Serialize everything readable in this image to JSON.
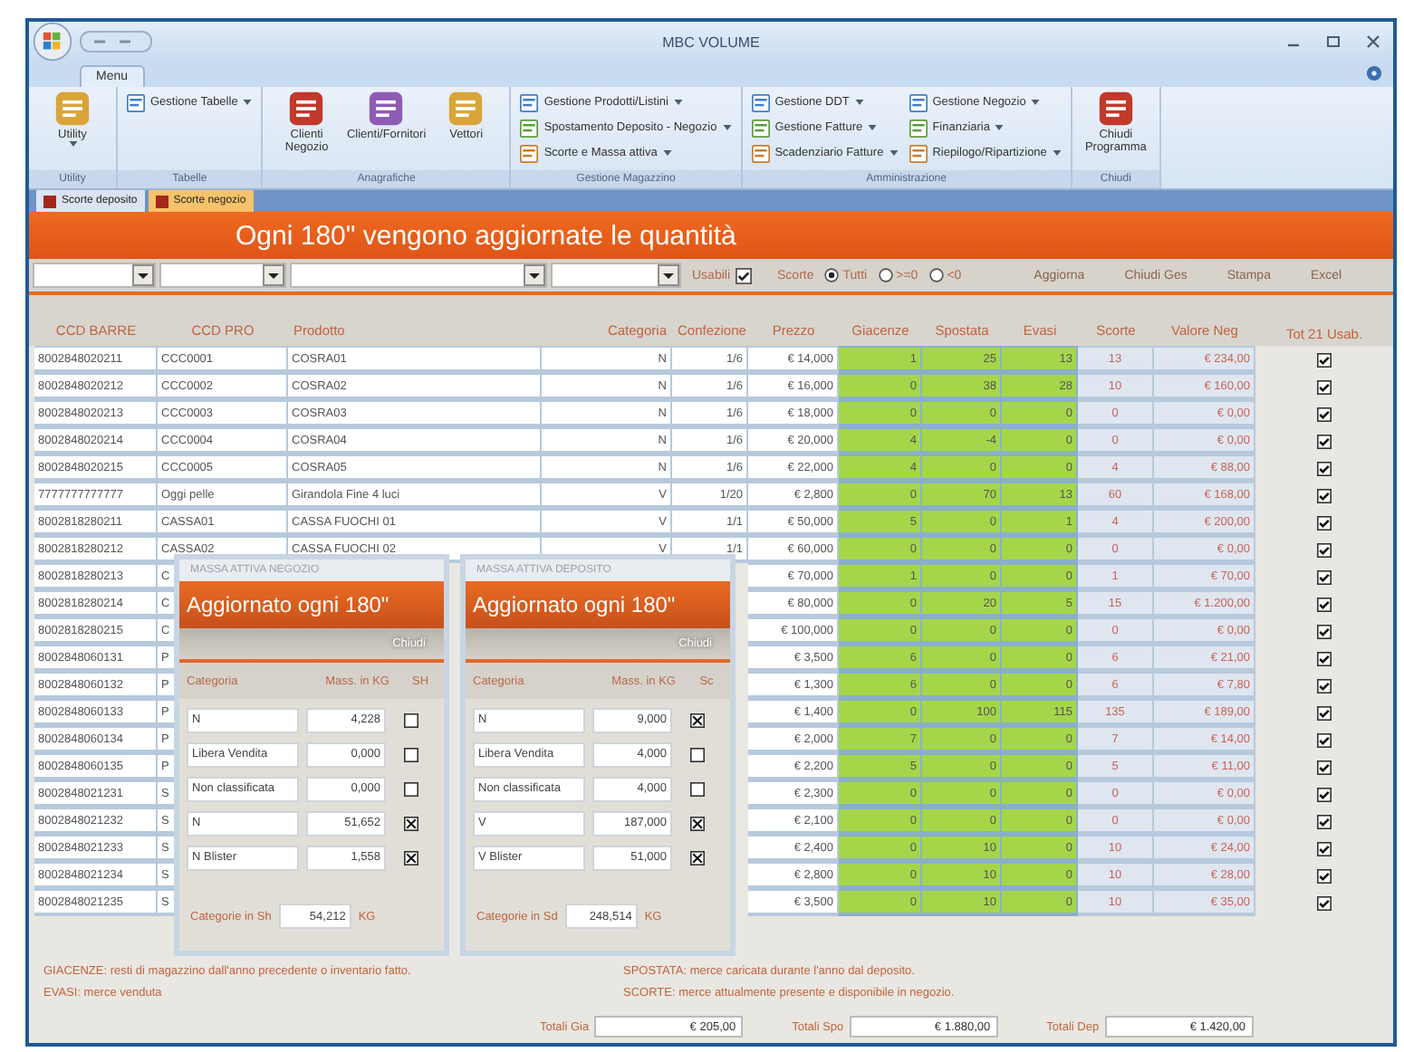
{
  "window": {
    "title": "MBC VOLUME"
  },
  "ribbon": {
    "tabs": [
      {
        "label": "Menu",
        "selected": true
      }
    ],
    "groups": [
      {
        "label": "Utility",
        "items": [
          {
            "label": "Utility",
            "kind": "large",
            "dropdown": true
          }
        ]
      },
      {
        "label": "Tabelle",
        "items": [
          {
            "label": "Gestione Tabelle",
            "kind": "small",
            "dropdown": true
          }
        ]
      },
      {
        "label": "Anagrafiche",
        "items": [
          {
            "label": "Clienti Negozio",
            "kind": "large",
            "dropdown": false
          },
          {
            "label": "Clienti/Fornitori",
            "kind": "large",
            "dropdown": false
          },
          {
            "label": "Vettori",
            "kind": "large",
            "dropdown": false
          }
        ]
      },
      {
        "label": "Gestione Magazzino",
        "items": [
          {
            "label": "Gestione Prodotti/Listini",
            "kind": "small",
            "dropdown": true
          },
          {
            "label": "Spostamento Deposito - Negozio",
            "kind": "small",
            "dropdown": true
          },
          {
            "label": "Scorte e Massa attiva",
            "kind": "small",
            "dropdown": true
          }
        ]
      },
      {
        "label": "Amministrazione",
        "items": [
          {
            "label": "Gestione DDT",
            "kind": "small",
            "dropdown": true
          },
          {
            "label": "Gestione Fatture",
            "kind": "small",
            "dropdown": true
          },
          {
            "label": "Scadenziario Fatture",
            "kind": "small",
            "dropdown": true
          },
          {
            "label": "Gestione Negozio",
            "kind": "small",
            "dropdown": true
          },
          {
            "label": "Finanziaria",
            "kind": "small",
            "dropdown": true
          },
          {
            "label": "Riepilogo/Ripartizione",
            "kind": "small",
            "dropdown": true
          }
        ]
      },
      {
        "label": "Chiudi",
        "items": [
          {
            "label": "Chiudi Programma",
            "kind": "large",
            "dropdown": false
          }
        ]
      }
    ]
  },
  "doc_tabs": [
    {
      "label": "Scorte deposito",
      "selected": false
    },
    {
      "label": "Scorte negozio",
      "selected": true
    }
  ],
  "banner": "Ogni 180\" vengono aggiornate le quantità",
  "filters": {
    "usable": {
      "label": "Usabili",
      "checked": true
    },
    "stock_filter": {
      "label": "Scorte",
      "options": [
        {
          "label": "Tutti",
          "selected": true
        },
        {
          "label": ">=0",
          "selected": false
        },
        {
          "label": "<0",
          "selected": false
        }
      ]
    },
    "buttons": [
      "Aggiorna",
      "Chiudi Ges",
      "Stampa",
      "Excel"
    ]
  },
  "table": {
    "columns": [
      "CCD BARRE",
      "CCD PRO",
      "Prodotto",
      "Categoria",
      "Confezione",
      "Prezzo",
      "Giacenze",
      "Spostata",
      "Evasi",
      "Scorte",
      "Valore Neg",
      "Tot 21 Usab."
    ],
    "rows": [
      {
        "barcode": "8002848020211",
        "code": "CCC0001",
        "product": "COSRA01",
        "category": "N",
        "pack": "1/6",
        "price": "€ 14,000",
        "stock_start": "1",
        "moved": "25",
        "sold": "13",
        "stock": "13",
        "value": "€ 234,00",
        "usable": true
      },
      {
        "barcode": "8002848020212",
        "code": "CCC0002",
        "product": "COSRA02",
        "category": "N",
        "pack": "1/6",
        "price": "€ 16,000",
        "stock_start": "0",
        "moved": "38",
        "sold": "28",
        "stock": "10",
        "value": "€ 160,00",
        "usable": true
      },
      {
        "barcode": "8002848020213",
        "code": "CCC0003",
        "product": "COSRA03",
        "category": "N",
        "pack": "1/6",
        "price": "€ 18,000",
        "stock_start": "0",
        "moved": "0",
        "sold": "0",
        "stock": "0",
        "value": "€ 0,00",
        "usable": true
      },
      {
        "barcode": "8002848020214",
        "code": "CCC0004",
        "product": "COSRA04",
        "category": "N",
        "pack": "1/6",
        "price": "€ 20,000",
        "stock_start": "4",
        "moved": "-4",
        "sold": "0",
        "stock": "0",
        "value": "€ 0,00",
        "usable": true
      },
      {
        "barcode": "8002848020215",
        "code": "CCC0005",
        "product": "COSRA05",
        "category": "N",
        "pack": "1/6",
        "price": "€ 22,000",
        "stock_start": "4",
        "moved": "0",
        "sold": "0",
        "stock": "4",
        "value": "€ 88,00",
        "usable": true
      },
      {
        "barcode": "7777777777777",
        "code": "Oggi pelle",
        "product": "Girandola Fine 4 luci",
        "category": "V",
        "pack": "1/20",
        "price": "€ 2,800",
        "stock_start": "0",
        "moved": "70",
        "sold": "13",
        "stock": "60",
        "value": "€ 168,00",
        "usable": true
      },
      {
        "barcode": "8002818280211",
        "code": "CASSA01",
        "product": "CASSA FUOCHI 01",
        "category": "V",
        "pack": "1/1",
        "price": "€ 50,000",
        "stock_start": "5",
        "moved": "0",
        "sold": "1",
        "stock": "4",
        "value": "€ 200,00",
        "usable": true
      },
      {
        "barcode": "8002818280212",
        "code": "CASSA02",
        "product": "CASSA FUOCHI 02",
        "category": "V",
        "pack": "1/1",
        "price": "€ 60,000",
        "stock_start": "0",
        "moved": "0",
        "sold": "0",
        "stock": "0",
        "value": "€ 0,00",
        "usable": true
      },
      {
        "barcode": "8002818280213",
        "code": "C",
        "price": "€ 70,000",
        "stock_start": "1",
        "moved": "0",
        "sold": "0",
        "stock": "1",
        "value": "€ 70,00",
        "usable": true
      },
      {
        "barcode": "8002818280214",
        "code": "C",
        "price": "€ 80,000",
        "stock_start": "0",
        "moved": "20",
        "sold": "5",
        "stock": "15",
        "value": "€ 1.200,00",
        "usable": true
      },
      {
        "barcode": "8002818280215",
        "code": "C",
        "price": "€ 100,000",
        "stock_start": "0",
        "moved": "0",
        "sold": "0",
        "stock": "0",
        "value": "€ 0,00",
        "usable": true
      },
      {
        "barcode": "8002848060131",
        "code": "P",
        "price": "€ 3,500",
        "stock_start": "6",
        "moved": "0",
        "sold": "0",
        "stock": "6",
        "value": "€ 21,00",
        "usable": true
      },
      {
        "barcode": "8002848060132",
        "code": "P",
        "price": "€ 1,300",
        "stock_start": "6",
        "moved": "0",
        "sold": "0",
        "stock": "6",
        "value": "€ 7,80",
        "usable": true
      },
      {
        "barcode": "8002848060133",
        "code": "P",
        "price": "€ 1,400",
        "stock_start": "0",
        "moved": "100",
        "sold": "115",
        "stock": "135",
        "value": "€ 189,00",
        "usable": true
      },
      {
        "barcode": "8002848060134",
        "code": "P",
        "price": "€ 2,000",
        "stock_start": "7",
        "moved": "0",
        "sold": "0",
        "stock": "7",
        "value": "€ 14,00",
        "usable": true
      },
      {
        "barcode": "8002848060135",
        "code": "P",
        "price": "€ 2,200",
        "stock_start": "5",
        "moved": "0",
        "sold": "0",
        "stock": "5",
        "value": "€ 11,00",
        "usable": true
      },
      {
        "barcode": "8002848021231",
        "code": "S",
        "price": "€ 2,300",
        "stock_start": "0",
        "moved": "0",
        "sold": "0",
        "stock": "0",
        "value": "€ 0,00",
        "usable": true
      },
      {
        "barcode": "8002848021232",
        "code": "S",
        "price": "€ 2,100",
        "stock_start": "0",
        "moved": "0",
        "sold": "0",
        "stock": "0",
        "value": "€ 0,00",
        "usable": true
      },
      {
        "barcode": "8002848021233",
        "code": "S",
        "price": "€ 2,400",
        "stock_start": "0",
        "moved": "10",
        "sold": "0",
        "stock": "10",
        "value": "€ 24,00",
        "usable": true
      },
      {
        "barcode": "8002848021234",
        "code": "S",
        "price": "€ 2,800",
        "stock_start": "0",
        "moved": "10",
        "sold": "0",
        "stock": "10",
        "value": "€ 28,00",
        "usable": true
      },
      {
        "barcode": "8002848021235",
        "code": "S",
        "price": "€ 3,500",
        "stock_start": "0",
        "moved": "10",
        "sold": "0",
        "stock": "10",
        "value": "€ 35,00",
        "usable": true
      }
    ]
  },
  "panels": [
    {
      "title": "MASSA ATTIVA NEGOZIO",
      "heading": "Aggiornato ogni 180\"",
      "button": "Chiudi",
      "columns": [
        "Categoria",
        "Mass. in KG",
        "SH"
      ],
      "rows": [
        {
          "category": "N",
          "mass": "4,228",
          "checked": false
        },
        {
          "category": "Libera Vendita",
          "mass": "0,000",
          "checked": false
        },
        {
          "category": "Non classificata",
          "mass": "0,000",
          "checked": false
        },
        {
          "category": "N",
          "mass": "51,652",
          "checked": true
        },
        {
          "category": "N Blister",
          "mass": "1,558",
          "checked": true
        }
      ],
      "footer_label": "Categorie in Sh",
      "footer_value": "54,212",
      "unit": "KG"
    },
    {
      "title": "MASSA ATTIVA DEPOSITO",
      "heading": "Aggiornato ogni 180\"",
      "button": "Chiudi",
      "columns": [
        "Categoria",
        "Mass. in KG",
        "Sc"
      ],
      "rows": [
        {
          "category": "N",
          "mass": "9,000",
          "checked": true
        },
        {
          "category": "Libera Vendita",
          "mass": "4,000",
          "checked": false
        },
        {
          "category": "Non classificata",
          "mass": "4,000",
          "checked": false
        },
        {
          "category": "V",
          "mass": "187,000",
          "checked": true
        },
        {
          "category": "V Blister",
          "mass": "51,000",
          "checked": true
        }
      ],
      "footer_label": "Categorie in Sd",
      "footer_value": "248,514",
      "unit": "KG"
    }
  ],
  "notes": [
    "GIACENZE: resti di magazzino dall'anno precedente o inventario fatto.",
    "SPOSTATA: merce caricata durante l'anno dal deposito.",
    "EVASI: merce venduta",
    "SCORTE: merce attualmente presente e disponibile in negozio."
  ],
  "totals": [
    {
      "label": "Totali Gia",
      "value": "€ 205,00"
    },
    {
      "label": "Totali Spo",
      "value": "€ 1.880,00"
    },
    {
      "label": "Totali Dep",
      "value": "€ 1.420,00"
    }
  ]
}
